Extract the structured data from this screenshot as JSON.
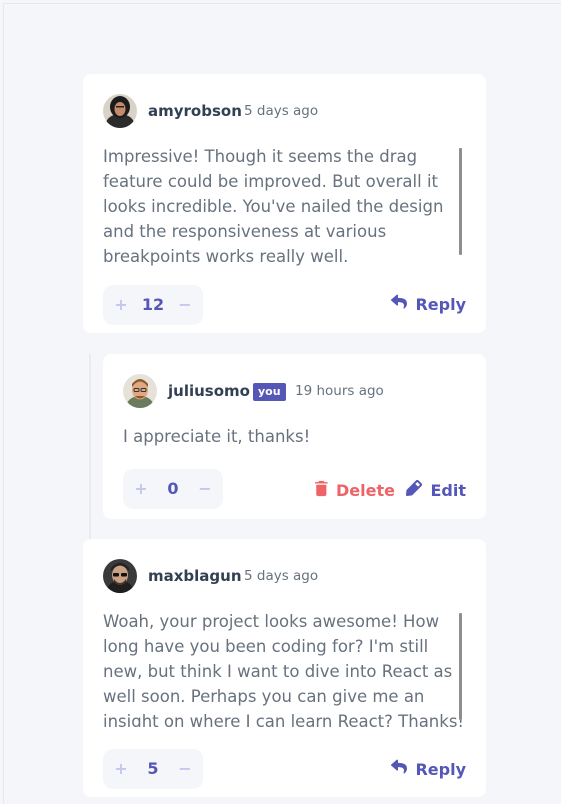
{
  "comments": [
    {
      "username": "amyrobson",
      "timestamp": "5 days ago",
      "text": "Impressive! Though it seems the drag feature could be improved. But overall it looks incredible. You've nailed the design and the responsiveness at various breakpoints works really well.",
      "score": "12",
      "reply_label": "Reply"
    },
    {
      "username": "juliusomo",
      "badge": "you",
      "timestamp": "19 hours ago",
      "text": "I appreciate it, thanks!",
      "score": "0",
      "delete_label": "Delete",
      "edit_label": "Edit"
    },
    {
      "username": "maxblagun",
      "timestamp": "5 days ago",
      "text": "Woah, your project looks awesome! How long have you been coding for? I'm still new, but think I want to dive into React as well soon. Perhaps you can give me an insight on where I can learn React? Thanks!",
      "score": "5",
      "reply_label": "Reply"
    }
  ],
  "vote": {
    "plus": "+",
    "minus": "−"
  },
  "colors": {
    "primary": "#5457b6",
    "primary_light": "#c5c6ef",
    "danger": "#ed6368",
    "text": "#67727e",
    "heading": "#324152",
    "background": "#f5f6fa",
    "card": "#ffffff"
  },
  "icons": {
    "reply": "reply-icon",
    "delete": "delete-icon",
    "edit": "edit-icon"
  }
}
